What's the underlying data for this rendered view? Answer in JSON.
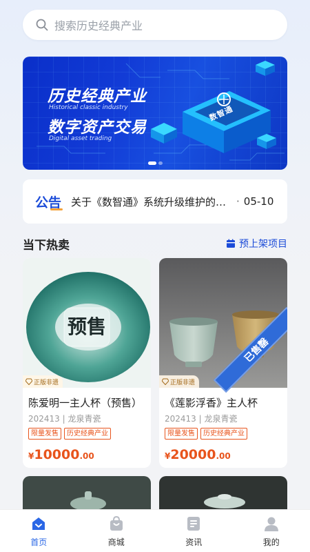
{
  "search": {
    "placeholder": "搜索历史经典产业"
  },
  "banner": {
    "title_cn": "历史经典产业",
    "title_en": "Historical classic industry",
    "subtitle_cn": "数字资产交易",
    "subtitle_en": "Digital asset trading",
    "logo_text": "数智通",
    "watermark": "历史经典产业",
    "page_count": 2,
    "active_page": 0
  },
  "notice": {
    "tag": "公告",
    "text": "关于《数智通》系统升级维护的通知",
    "date": "05-10"
  },
  "section": {
    "title": "当下热卖",
    "presale_label": "预上架项目"
  },
  "products": [
    {
      "name": "陈爱明一主人杯（预售）",
      "meta": "202413 | 龙泉青瓷",
      "tags": [
        "限量发售",
        "历史经典产业"
      ],
      "price_currency": "¥",
      "price_int": "10000",
      "price_dec": ".00",
      "badge": "正版非遗",
      "image_text": "预售",
      "sold": false
    },
    {
      "name": "《莲影浮香》主人杯",
      "meta": "202413 | 龙泉青瓷",
      "tags": [
        "限量发售",
        "历史经典产业"
      ],
      "price_currency": "¥",
      "price_int": "20000",
      "price_dec": ".00",
      "badge": "正版非遗",
      "image_text": "",
      "sold": true,
      "sold_label": "已售罄"
    }
  ],
  "tabbar": [
    {
      "label": "首页",
      "icon": "home-icon",
      "active": true
    },
    {
      "label": "商城",
      "icon": "shop-bag-icon",
      "active": false
    },
    {
      "label": "资讯",
      "icon": "news-icon",
      "active": false
    },
    {
      "label": "我的",
      "icon": "user-icon",
      "active": false
    }
  ],
  "colors": {
    "accent": "#1b4bd8",
    "price": "#e8541c",
    "tab_active": "#2a67e6",
    "notice_underline": "#f3a13a"
  }
}
